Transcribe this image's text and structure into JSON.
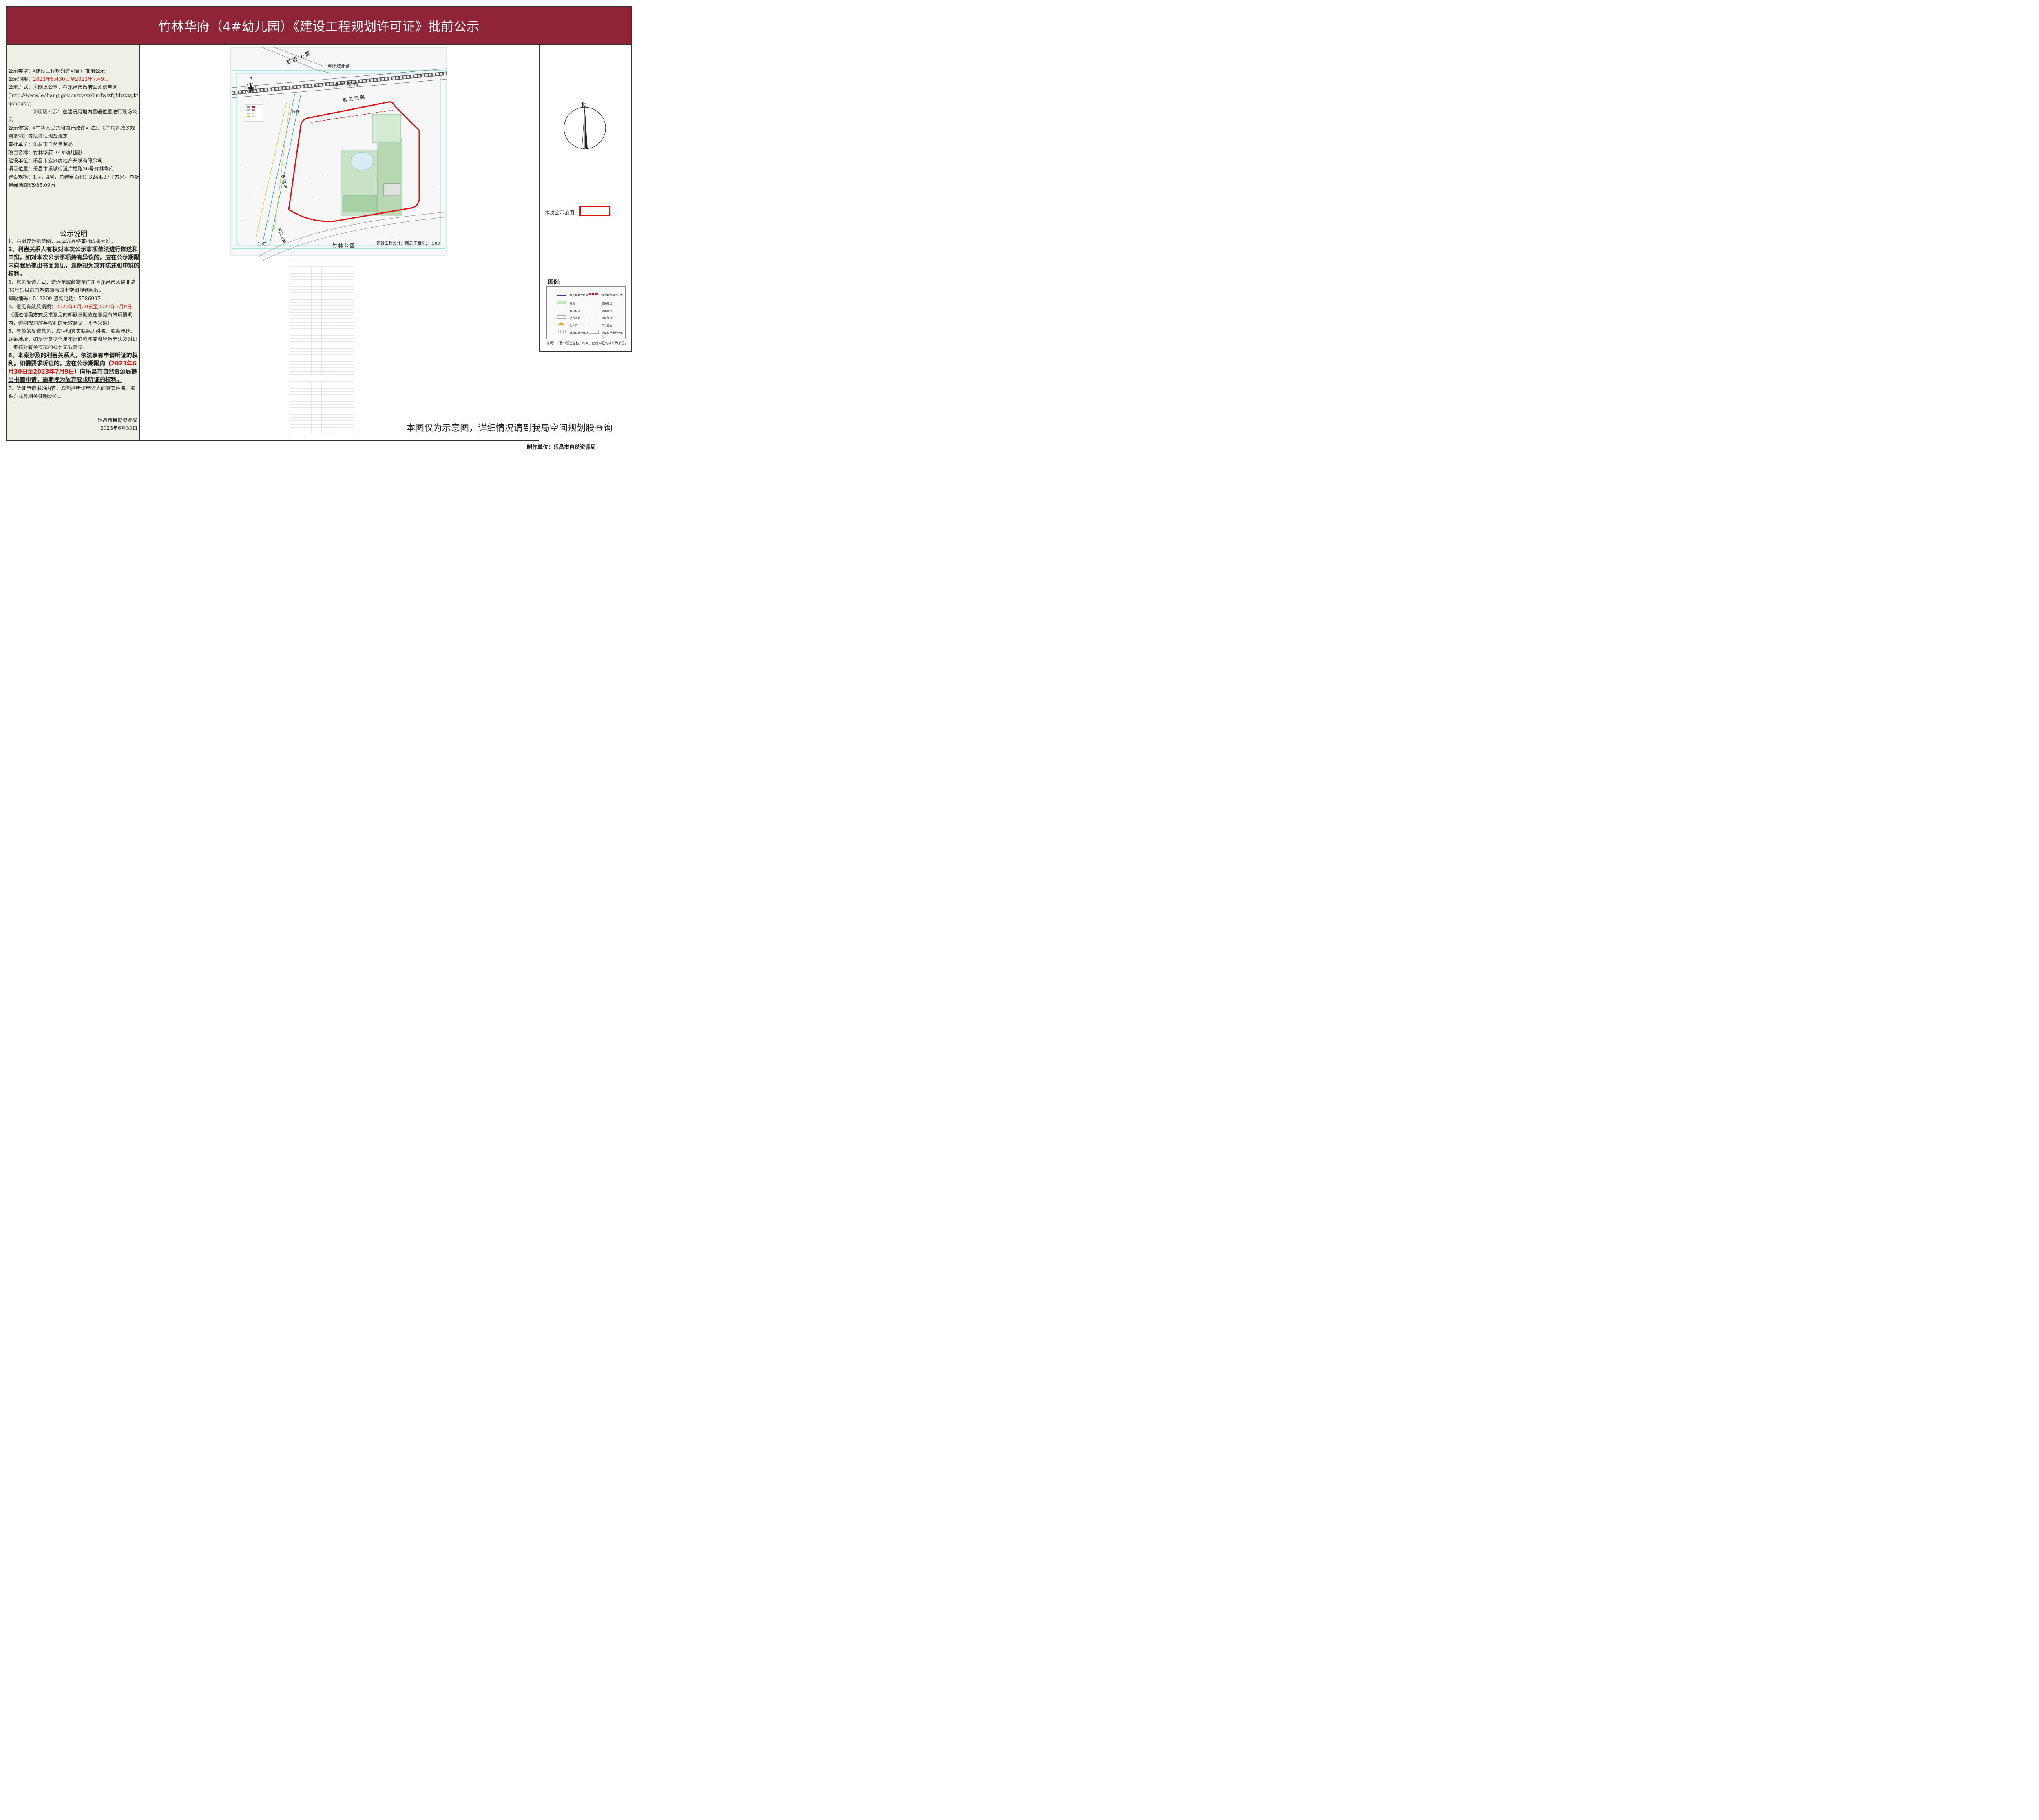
{
  "title": "竹林华府（4#幼儿园）《建设工程规划许可证》批前公示",
  "info": {
    "type": "公示类型：《建设工程规划许可证》批前公示",
    "period_label": "公示期限：",
    "period_value": "2023年6月30日至2023年7月9日",
    "method1": "公示方式：①网上公示：在乐昌市政府公众信息网",
    "method1_url": "(http://www.lechang.gov.cn/xwzx/bmfw/zfghbzxxgk/gcbpgst/)",
    "method2": "②现场公示：在建设用地内显著位置进行现场公示",
    "basis": "公示依据：《中华人民共和国行政许可法》、《广东省城乡规划条例》等法律法规及规定",
    "approver": "审批单位：乐昌市自然资源局",
    "project": "项目名称：竹林华府（4#幼儿园）",
    "builder": "建设单位：乐昌市宏兴房地产开发有限公司",
    "location": "项目位置：乐昌市乐城街道广福路36号竹林华府",
    "scale": "建设规模：1座，4层，总建筑面积：3244.87平方米。总配建绿地面积985.09㎡"
  },
  "notes": {
    "heading": "公示说明",
    "n1": "1、右图仅为示意图，具体以最终审批成果为准。",
    "n2": "2、利害关系人有权对本次公示事项依法进行陈述和申辩，如对本次公示事项持有异议的，应在公示期限内向我局提出书面意见，逾期视为放弃陈述和申辩的权利。",
    "n3": "3、意见反馈方式：请送至或邮寄至广东省乐昌市人民北路36号乐昌市自然资源局国土空间规划股收。",
    "n3b": "邮政编码：512200  咨询电话：5586997",
    "n4_pre": "4、意见有效反馈期：",
    "n4_date": "2023年6月30日至2023年7月9日",
    "n4_post": "（通过信函方式反馈意见的邮戳日期应在意见有效反馈期内，逾期视为放弃权利的无效意见，不予采纳）",
    "n5": "5、有效的反馈意见：应注明真实联系人姓名、联系电话、联系地址，如反馈意见信息不准确或不完整导致无法及时进一步核对有关情况的视为无效意见。",
    "n6_pre": "6、本案涉及的利害关系人，依法享有申请听证的权利。如需要求听证的，应在公示期限内（",
    "n6_date": "2023年6月30日至2023年7月9日",
    "n6_post": "）向乐昌市自然资源局提出书面申请，逾期视为放弃要求听证的权利。",
    "n7": "7、听证申请书的内容：应包括听证申请人的真实姓名，联系方式及相关证明材料。",
    "org": "乐昌市自然资源局",
    "date": "2023年6月30日"
  },
  "map": {
    "road_laohutou": "老 虎 头 路",
    "road_huanchengbei": "至环城北路",
    "road_jingguang": "京  广  铁  路",
    "road_huangpiyuan": "黄 皮 园 路",
    "greenline": "绿线",
    "river_xikeng": "西 坑 水",
    "wujiang": "武  江",
    "wujiang_road": "武江上路",
    "zhulin_park": "竹  林  公  园",
    "plan_caption": "建设工程设计方案总平面图1：500",
    "north_small": "N"
  },
  "right_panel": {
    "north": "北",
    "scope_label": "本次公示范围",
    "legend_title": "图例:",
    "legend_items": [
      "规划建筑及层数",
      "规划建设用地红线",
      "绿地",
      "道路红线",
      "坐标标注",
      "道路中线",
      "区内道路",
      "建筑红线",
      "出入口",
      "尺寸标注",
      "非机动车停车场",
      "植草砖充电桩停车位"
    ],
    "legend_note": "说明：1.图中所注坐标、标高、曲线半径均以米为单位。"
  },
  "footer": {
    "disclaimer": "本图仅为示意图，详细情况请到我局空间规划股查询",
    "maker": "制作单位：乐昌市自然资源局"
  },
  "colors": {
    "title_bg": "#8e2435",
    "left_bg": "#eef0e6",
    "redline": "#e01010"
  }
}
